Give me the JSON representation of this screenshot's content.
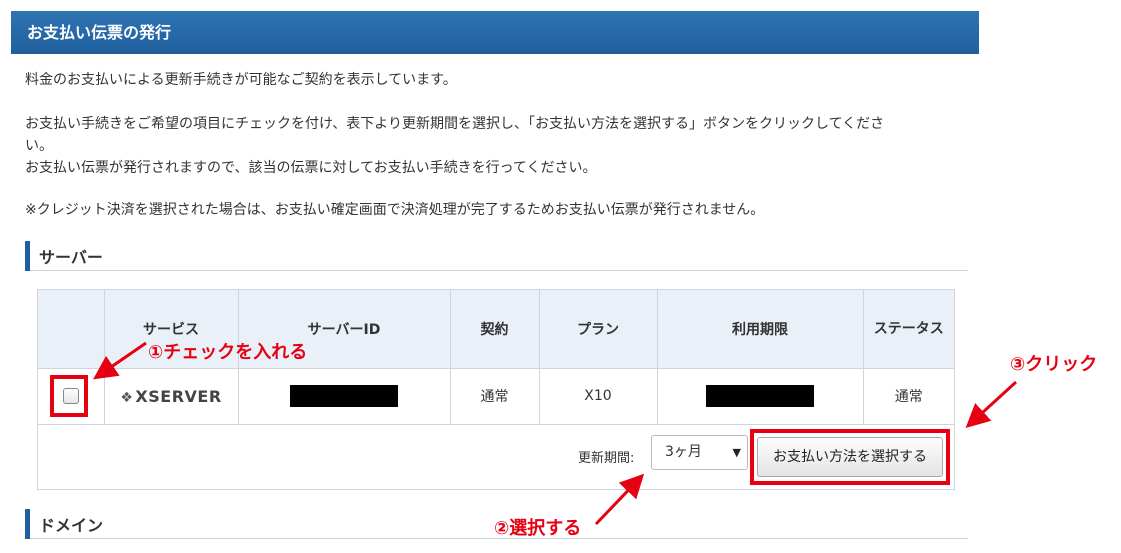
{
  "header": {
    "title": "お支払い伝票の発行"
  },
  "intro": {
    "line1": "料金のお支払いによる更新手続きが可能なご契約を表示しています。",
    "line2a": "お支払い手続きをご希望の項目にチェックを付け、表下より更新期間を選択し、「お支払い方法を選択する」ボタンをクリックしてくださ",
    "line2b": "い。",
    "line3": "お支払い伝票が発行されますので、該当の伝票に対してお支払い手続きを行ってください。",
    "line4": "※クレジット決済を選択された場合は、お支払い確定画面で決済処理が完了するためお支払い伝票が発行されません。"
  },
  "server_section": {
    "title": "サーバー"
  },
  "table": {
    "headers": [
      "サービス",
      "サーバーID",
      "契約",
      "プラン",
      "利用期限",
      "ステータス"
    ],
    "row": {
      "service_logo": "XSERVER",
      "contract": "通常",
      "plan": "X10",
      "status": "通常"
    }
  },
  "renewal": {
    "label": "更新期間:",
    "selected": "3ヶ月",
    "button": "お支払い方法を選択する"
  },
  "domain_section": {
    "title": "ドメイン"
  },
  "annotations": {
    "step1": "①チェックを入れる",
    "step2": "②選択する",
    "step3": "③クリック"
  },
  "colors": {
    "header": "#1f5f9e",
    "annotation": "#e60012",
    "table_header": "#e9f0f8"
  },
  "icons": {
    "dropdown": "triangle-down-icon",
    "logo_mark": "xserver-diamond-icon"
  }
}
